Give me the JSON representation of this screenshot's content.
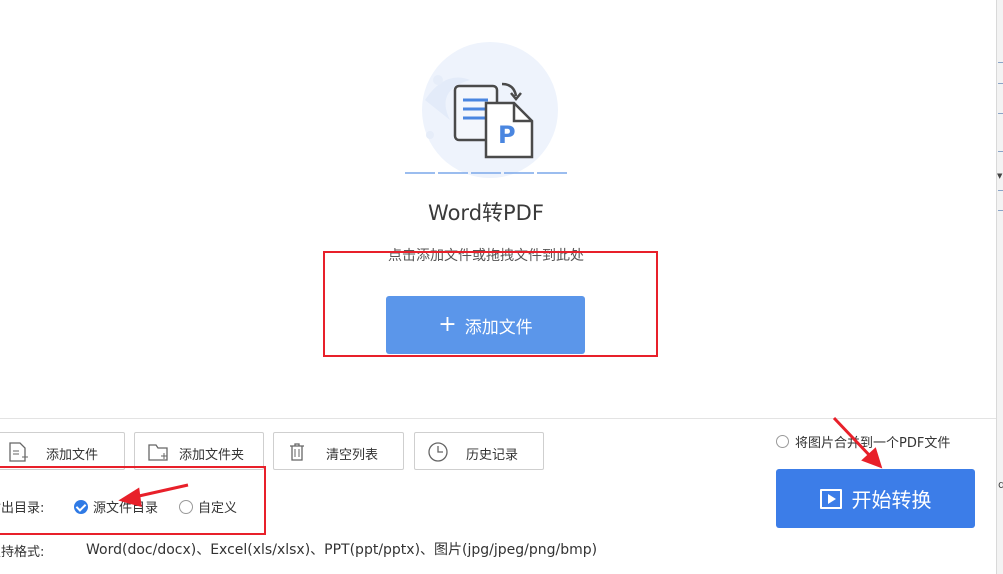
{
  "main": {
    "title": "Word转PDF",
    "hint": "点击添加文件或拖拽文件到此处",
    "add_button_label": "添加文件"
  },
  "toolbar": {
    "add_file_label": "添加文件",
    "add_folder_label": "添加文件夹",
    "clear_list_label": "清空列表",
    "history_label": "历史记录"
  },
  "output": {
    "label": "输出目录:",
    "options": [
      {
        "label": "源文件目录",
        "selected": true
      },
      {
        "label": "自定义",
        "selected": false
      }
    ]
  },
  "formats": {
    "label": "支持格式:",
    "value": "Word(doc/docx)、Excel(xls/xlsx)、PPT(ppt/pptx)、图片(jpg/jpeg/png/bmp)"
  },
  "merge_option": {
    "label": "将图片合并到一个PDF文件",
    "checked": false
  },
  "start_button_label": "开始转换",
  "colors": {
    "primary": "#3c7de8",
    "add_button": "#5b96ea",
    "annotation_red": "#e8202a"
  },
  "icons": [
    "word-to-pdf-illustration",
    "plus-icon",
    "add-file-icon",
    "add-folder-icon",
    "trash-icon",
    "clock-icon",
    "play-icon",
    "check-icon"
  ]
}
